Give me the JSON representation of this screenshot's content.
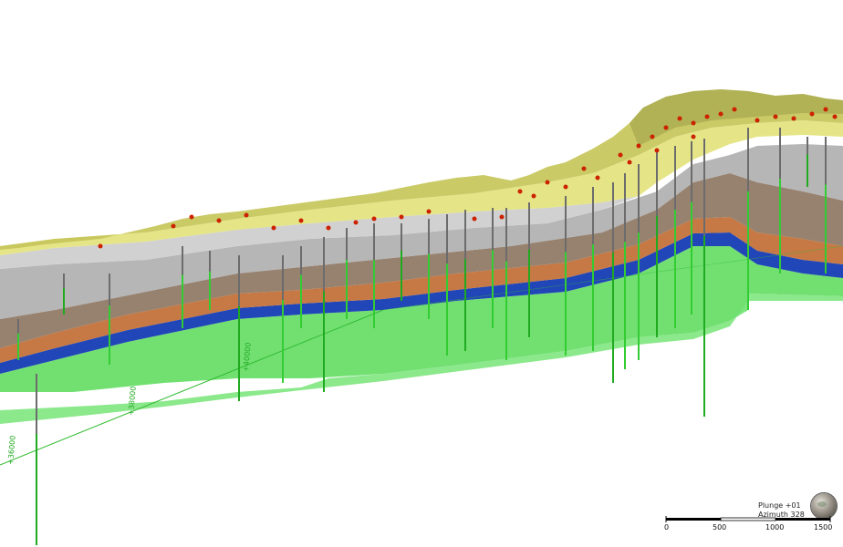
{
  "viewer": {
    "orientation": {
      "plunge_label": "Plunge +01",
      "azimuth_label": "Azimuth 328"
    },
    "scale_bar": {
      "ticks": [
        "0",
        "500",
        "1000",
        "1500"
      ]
    },
    "grid_labels": [
      "+36000",
      "+38000",
      "+40000"
    ],
    "colors": {
      "surface": "#c8c85a",
      "upper_layer": "#e2e27a",
      "grey_layer": "#a8a8a8",
      "brown_layer": "#8c7460",
      "orange_layer": "#d9772a",
      "blue_layer": "#2146b8",
      "basement": "#62dd62",
      "borehole": "#33bb33",
      "hotspots": "#cc2200"
    }
  }
}
